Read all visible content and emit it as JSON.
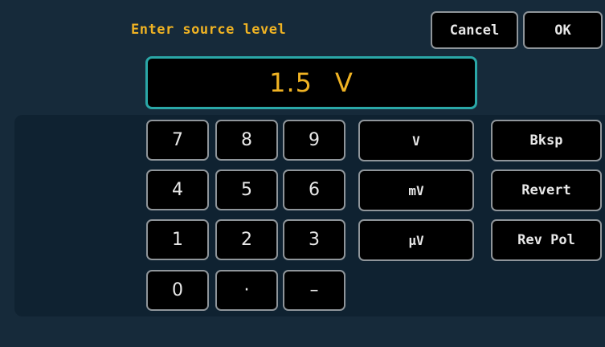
{
  "header": {
    "title": "Enter source level",
    "cancel_label": "Cancel",
    "ok_label": "OK"
  },
  "display": {
    "value": "1.5",
    "unit": "V"
  },
  "keypad": {
    "digits": {
      "k7": "7",
      "k8": "8",
      "k9": "9",
      "k4": "4",
      "k5": "5",
      "k6": "6",
      "k1": "1",
      "k2": "2",
      "k3": "3",
      "k0": "0",
      "dot": "·",
      "minus": "–"
    },
    "units": {
      "v": "V",
      "mv": "mV",
      "uv": "µV"
    },
    "actions": {
      "bksp": "Bksp",
      "revert": "Revert",
      "rev_pol": "Rev Pol"
    }
  },
  "colors": {
    "background": "#162a3a",
    "panel": "#0f2231",
    "accent": "#f0b323",
    "display_border": "#2aa7a7",
    "button_border": "#8f959a"
  }
}
